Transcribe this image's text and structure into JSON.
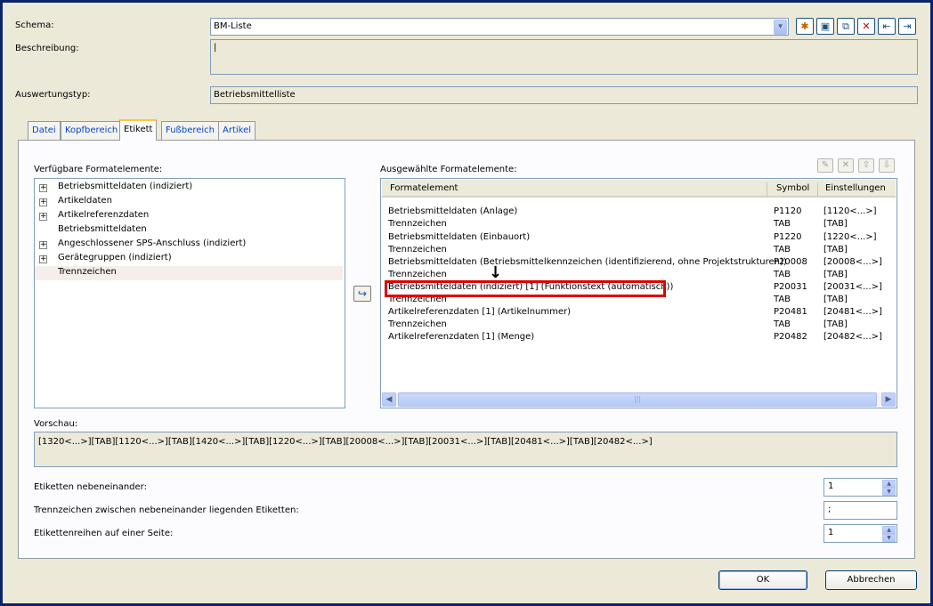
{
  "header": {
    "schema_label": "Schema:",
    "schema_value": "BM-Liste",
    "description_label": "Beschreibung:",
    "description_value": "|",
    "evaltype_label": "Auswertungstyp:",
    "evaltype_value": "Betriebsmittelliste",
    "toolbar_icons": [
      "new-icon",
      "save-icon",
      "copy-icon",
      "delete-icon",
      "import-icon",
      "export-icon"
    ],
    "toolbar_glyphs": [
      "✱",
      "▣",
      "⧉",
      "✕",
      "⇤",
      "⇥"
    ]
  },
  "tabs": [
    {
      "label": "Datei",
      "active": false
    },
    {
      "label": "Kopfbereich",
      "active": false
    },
    {
      "label": "Etikett",
      "active": true
    },
    {
      "label": "Fußbereich",
      "active": false
    },
    {
      "label": "Artikel",
      "active": false
    }
  ],
  "available": {
    "label": "Verfügbare Formatelemente:",
    "items": [
      {
        "label": "Betriebsmitteldaten (indiziert)",
        "expandable": true
      },
      {
        "label": "Artikeldaten",
        "expandable": true
      },
      {
        "label": "Artikelreferenzdaten",
        "expandable": true
      },
      {
        "label": "Betriebsmitteldaten",
        "expandable": false
      },
      {
        "label": "Angeschlossener SPS-Anschluss (indiziert)",
        "expandable": true
      },
      {
        "label": "Gerätegruppen (indiziert)",
        "expandable": true
      },
      {
        "label": "Trennzeichen",
        "expandable": false,
        "selected": true
      }
    ],
    "expand_glyph": "+"
  },
  "transfer_button_glyph": "↪",
  "selected": {
    "label": "Ausgewählte Formatelemente:",
    "columns": [
      "Formatelement",
      "Symbol",
      "Einstellungen"
    ],
    "rows": [
      {
        "element": "Betriebsmitteldaten (Anlage)",
        "symbol": "P1120",
        "settings": "[1120<...>]"
      },
      {
        "element": "Trennzeichen",
        "symbol": "TAB",
        "settings": "[TAB]"
      },
      {
        "element": "Betriebsmitteldaten (Einbauort)",
        "symbol": "P1220",
        "settings": "[1220<...>]"
      },
      {
        "element": "Trennzeichen",
        "symbol": "TAB",
        "settings": "[TAB]"
      },
      {
        "element": "Betriebsmitteldaten (Betriebsmittelkennzeichen (identifizierend, ohne Projektstrukturen))",
        "symbol": "P20008",
        "settings": "[20008<...>]"
      },
      {
        "element": "Trennzeichen",
        "symbol": "TAB",
        "settings": "[TAB]"
      },
      {
        "element": "Betriebsmitteldaten (indiziert) [1] (Funktionstext (automatisch))",
        "symbol": "P20031",
        "settings": "[20031<...>]"
      },
      {
        "element": "Trennzeichen",
        "symbol": "TAB",
        "settings": "[TAB]"
      },
      {
        "element": "Artikelreferenzdaten [1] (Artikelnummer)",
        "symbol": "P20481",
        "settings": "[20481<...>]"
      },
      {
        "element": "Trennzeichen",
        "symbol": "TAB",
        "settings": "[TAB]"
      },
      {
        "element": "Artikelreferenzdaten [1] (Menge)",
        "symbol": "P20482",
        "settings": "[20482<...>]"
      }
    ],
    "action_icons": [
      "edit-icon",
      "remove-icon",
      "move-up-icon",
      "move-down-icon"
    ],
    "action_glyphs": [
      "✎",
      "✕",
      "⇧",
      "⇩"
    ],
    "scroll_left": "◀",
    "scroll_right": "▶",
    "scroll_grip": "|||",
    "pointer_arrow": "↓"
  },
  "preview": {
    "label": "Vorschau:",
    "value": "[1320<...>][TAB][1120<...>][TAB][1420<...>][TAB][1220<...>][TAB][20008<...>][TAB][20031<...>][TAB][20481<...>][TAB][20482<...>]"
  },
  "settings": {
    "labels_side_by_side_label": "Etiketten nebeneinander:",
    "labels_side_by_side_value": "1",
    "separator_label": "Trennzeichen zwischen nebeneinander liegenden Etiketten:",
    "separator_value": ";",
    "rows_per_page_label": "Etikettenreihen auf einer Seite:",
    "rows_per_page_value": "1",
    "spin_up": "▲",
    "spin_down": "▼"
  },
  "combo_arrow": "▾",
  "footer": {
    "ok_label": "OK",
    "cancel_label": "Abbrechen"
  }
}
